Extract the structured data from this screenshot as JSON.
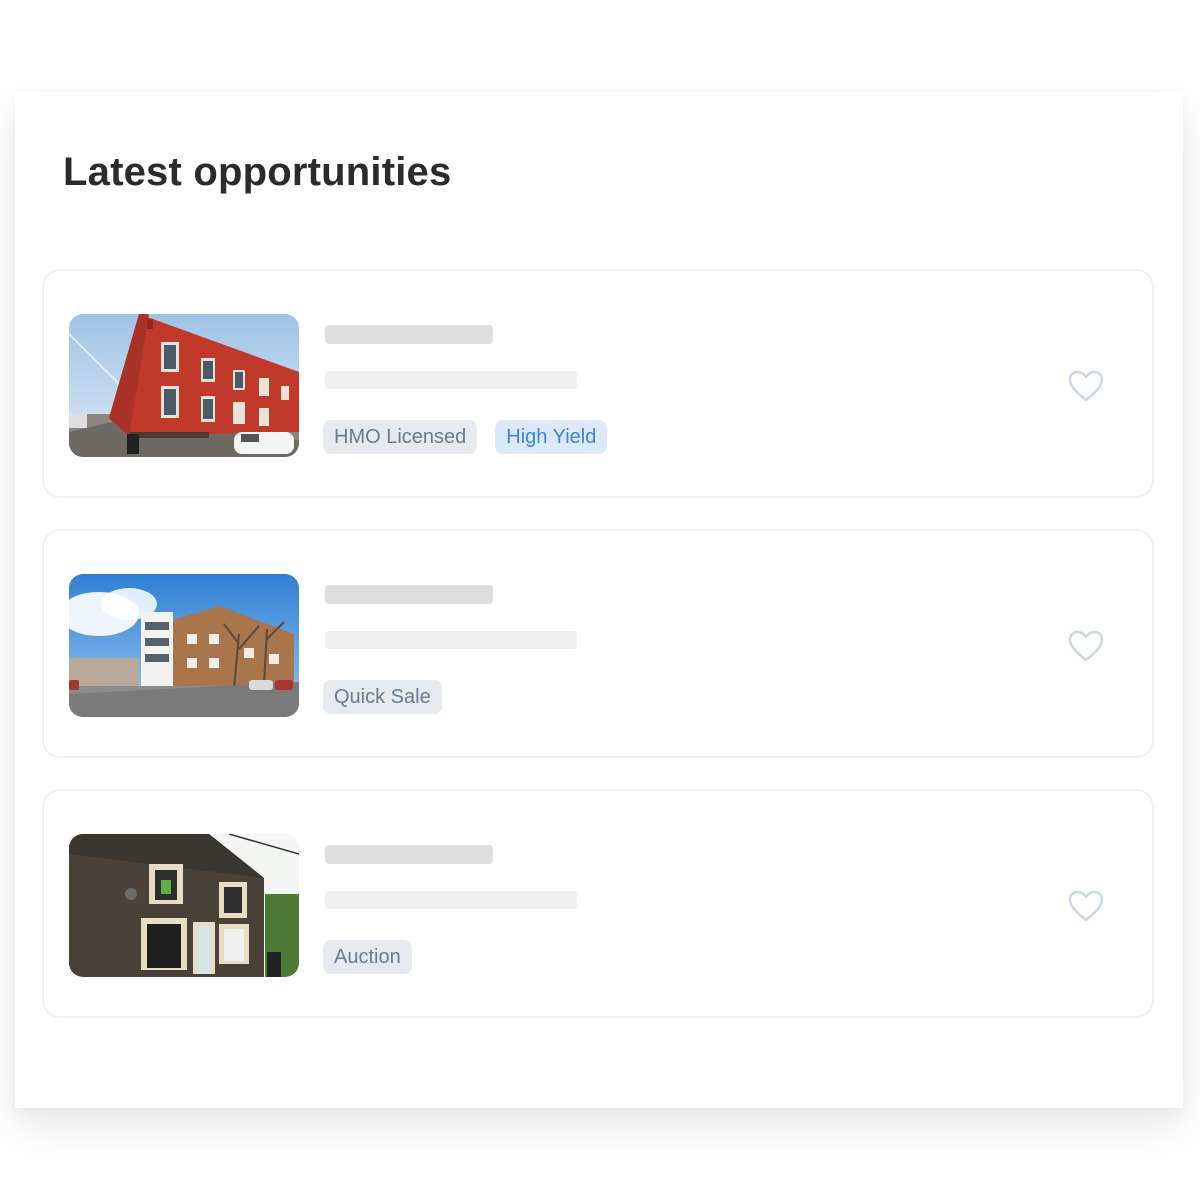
{
  "panel": {
    "title": "Latest opportunities"
  },
  "listings": [
    {
      "tags": [
        {
          "label": "HMO Licensed",
          "style": "neutral"
        },
        {
          "label": "High Yield",
          "style": "accent"
        }
      ],
      "favorite_icon": "heart-outline-icon"
    },
    {
      "tags": [
        {
          "label": "Quick Sale",
          "style": "neutral"
        }
      ],
      "favorite_icon": "heart-outline-icon"
    },
    {
      "tags": [
        {
          "label": "Auction",
          "style": "neutral"
        }
      ],
      "favorite_icon": "heart-outline-icon"
    }
  ],
  "colors": {
    "tag_neutral_bg": "#e6e9ee",
    "tag_neutral_text": "#6b7a90",
    "tag_accent_bg": "#dbe9fb",
    "tag_accent_text": "#3b82e6",
    "heart_outline": "#c9d6ea",
    "skeleton_dark": "#dedede",
    "skeleton_light": "#efefef"
  }
}
